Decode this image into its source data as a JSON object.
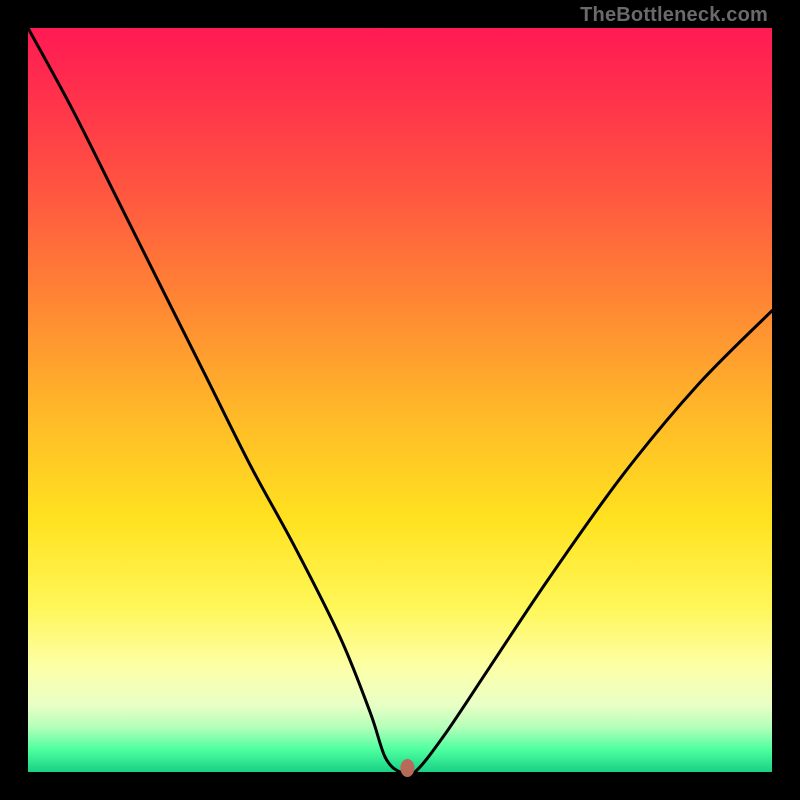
{
  "watermark": "TheBottleneck.com",
  "chart_data": {
    "type": "line",
    "title": "",
    "xlabel": "",
    "ylabel": "",
    "xlim": [
      0,
      100
    ],
    "ylim": [
      0,
      100
    ],
    "series": [
      {
        "name": "bottleneck-curve",
        "x": [
          0,
          6,
          12,
          18,
          24,
          30,
          36,
          42,
          46,
          48,
          50,
          52,
          56,
          62,
          70,
          80,
          90,
          100
        ],
        "values": [
          100,
          89,
          77,
          65,
          53,
          41,
          30,
          18,
          8,
          2,
          0,
          0,
          5,
          14,
          26,
          40,
          52,
          62
        ]
      }
    ],
    "marker": {
      "x": 51,
      "y": 0,
      "color": "#b86a5a"
    },
    "gradient_stops": [
      {
        "pos": 0,
        "color": "#ff1a53"
      },
      {
        "pos": 8,
        "color": "#ff2e4d"
      },
      {
        "pos": 22,
        "color": "#ff5640"
      },
      {
        "pos": 38,
        "color": "#ff8a33"
      },
      {
        "pos": 52,
        "color": "#ffb928"
      },
      {
        "pos": 66,
        "color": "#ffe21f"
      },
      {
        "pos": 78,
        "color": "#fff75a"
      },
      {
        "pos": 86,
        "color": "#fcffa8"
      },
      {
        "pos": 91,
        "color": "#e9ffc6"
      },
      {
        "pos": 94,
        "color": "#b4ffb9"
      },
      {
        "pos": 97,
        "color": "#4dffa0"
      },
      {
        "pos": 100,
        "color": "#18d184"
      }
    ]
  }
}
